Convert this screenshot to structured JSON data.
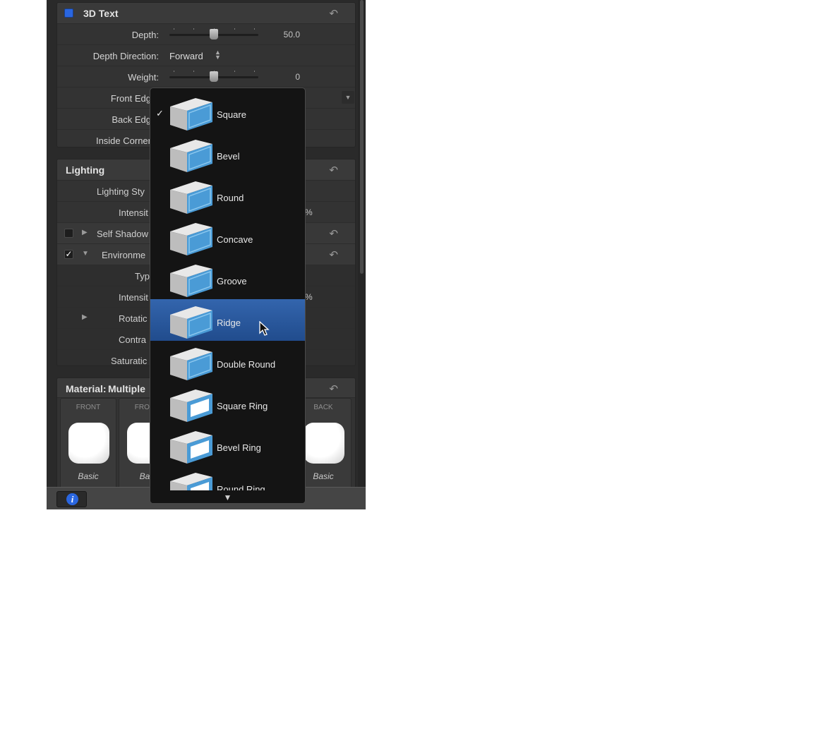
{
  "text3d": {
    "title": "3D Text",
    "depth": {
      "label": "Depth:",
      "value": "50.0",
      "fraction": 0.5
    },
    "depth_direction": {
      "label": "Depth Direction:",
      "value": "Forward"
    },
    "weight": {
      "label": "Weight:",
      "value": "0",
      "fraction": 0.5
    },
    "front_edge_label": "Front Edg",
    "back_edge_label": "Back Edg",
    "inside_corners_label": "Inside Corner"
  },
  "lighting": {
    "title": "Lighting",
    "lighting_style_label": "Lighting Sty",
    "intensity_label": "Intensit",
    "intensity_suffix": "%",
    "self_shadows_label": "Self Shadow",
    "self_shadows_checked": false,
    "environment_label": "Environme",
    "environment_checked": true,
    "check_glyph": "✓",
    "type_label": "Typ",
    "env_intensity_label": "Intensit",
    "env_intensity_suffix": "%",
    "rotation_label": "Rotatic",
    "contrast_label": "Contra",
    "saturation_label": "Saturatic"
  },
  "material": {
    "title": "Material:",
    "value": "Multiple",
    "slots": [
      {
        "header": "FRONT",
        "label": "Basic"
      },
      {
        "header": "FRONT",
        "label": "Bas"
      },
      {
        "header": "BACK",
        "label": "Basic"
      }
    ]
  },
  "dropdown": {
    "items": [
      {
        "label": "Square",
        "checked": true,
        "selected": false,
        "icon": "square-edge-icon"
      },
      {
        "label": "Bevel",
        "checked": false,
        "selected": false,
        "icon": "bevel-edge-icon"
      },
      {
        "label": "Round",
        "checked": false,
        "selected": false,
        "icon": "round-edge-icon"
      },
      {
        "label": "Concave",
        "checked": false,
        "selected": false,
        "icon": "concave-edge-icon"
      },
      {
        "label": "Groove",
        "checked": false,
        "selected": false,
        "icon": "groove-edge-icon"
      },
      {
        "label": "Ridge",
        "checked": false,
        "selected": true,
        "icon": "ridge-edge-icon"
      },
      {
        "label": "Double Round",
        "checked": false,
        "selected": false,
        "icon": "double-round-edge-icon"
      },
      {
        "label": "Square Ring",
        "checked": false,
        "selected": false,
        "icon": "square-ring-edge-icon"
      },
      {
        "label": "Bevel Ring",
        "checked": false,
        "selected": false,
        "icon": "bevel-ring-edge-icon"
      },
      {
        "label": "Round Ring",
        "checked": false,
        "selected": false,
        "icon": "round-ring-edge-icon"
      }
    ],
    "check_glyph": "✓",
    "more_glyph": "▼"
  },
  "colors": {
    "accent": "#2a66e0",
    "selection": "#2b5aa0",
    "thumb_blue": "#4a9bd6"
  }
}
